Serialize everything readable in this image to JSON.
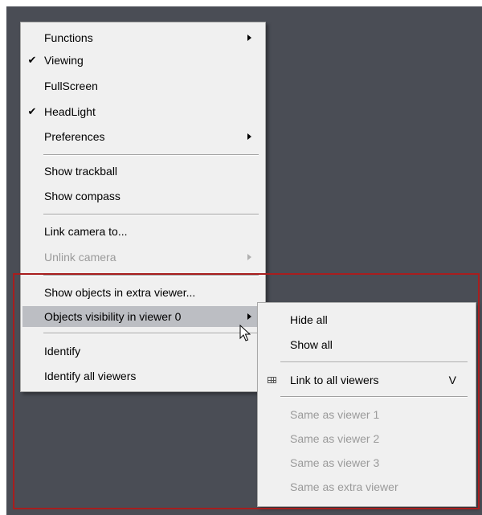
{
  "main_menu": {
    "items": [
      {
        "label": "Functions",
        "checked": false,
        "submenu": true,
        "disabled": false
      },
      {
        "label": "Viewing",
        "checked": true,
        "submenu": false,
        "disabled": false
      },
      {
        "label": "FullScreen",
        "checked": false,
        "submenu": false,
        "disabled": false
      },
      {
        "label": "HeadLight",
        "checked": true,
        "submenu": false,
        "disabled": false
      },
      {
        "label": "Preferences",
        "checked": false,
        "submenu": true,
        "disabled": false
      },
      {
        "label": "Show trackball",
        "checked": false,
        "submenu": false,
        "disabled": false
      },
      {
        "label": "Show compass",
        "checked": false,
        "submenu": false,
        "disabled": false
      },
      {
        "label": "Link camera to...",
        "checked": false,
        "submenu": false,
        "disabled": false
      },
      {
        "label": "Unlink camera",
        "checked": false,
        "submenu": true,
        "disabled": true
      },
      {
        "label": "Show objects in extra viewer...",
        "checked": false,
        "submenu": false,
        "disabled": false
      },
      {
        "label": "Objects visibility in viewer 0",
        "checked": false,
        "submenu": true,
        "disabled": false,
        "highlighted": true
      },
      {
        "label": "Identify",
        "checked": false,
        "submenu": false,
        "disabled": false
      },
      {
        "label": "Identify all viewers",
        "checked": false,
        "submenu": false,
        "disabled": false
      }
    ],
    "check_glyph": "✔"
  },
  "sub_menu": {
    "items": [
      {
        "label": "Hide all",
        "disabled": false
      },
      {
        "label": "Show all",
        "disabled": false
      },
      {
        "label": "Link to all viewers",
        "shortcut": "V",
        "icon": "grid-icon",
        "disabled": false
      },
      {
        "label": "Same as viewer 1",
        "disabled": true
      },
      {
        "label": "Same as viewer 2",
        "disabled": true
      },
      {
        "label": "Same as viewer 3",
        "disabled": true
      },
      {
        "label": "Same as extra viewer",
        "disabled": true
      }
    ]
  },
  "colors": {
    "viewer_background": "#4a4d55",
    "menu_background": "#f0f0f0",
    "highlight": "#bcbec3",
    "selection_box": "#a81e1e",
    "disabled_text": "#9a9a9a"
  }
}
